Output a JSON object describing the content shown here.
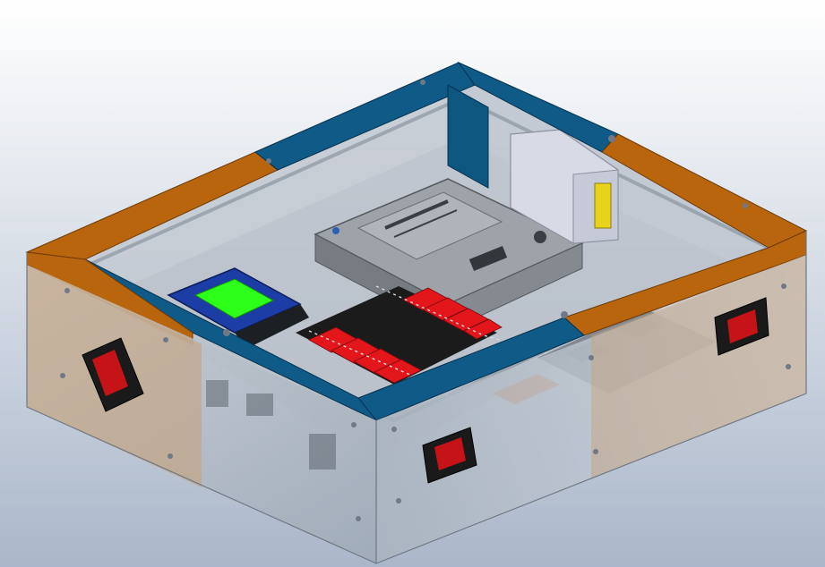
{
  "scene": {
    "background_light": "#ffffff",
    "background_dark": "#aab7ca",
    "colors": {
      "frame_blue": "#0f5a86",
      "frame_blue_dark": "#0a3f60",
      "frame_orange": "#b9650e",
      "frame_orange_dark": "#8a4808",
      "panel_glass": "#b9c3cf",
      "panel_tan": "#c7a17a",
      "board_gray": "#9ea3aa",
      "display_blue": "#1d3da6",
      "display_green": "#2dff1a",
      "terminal_red": "#e3161b",
      "terminal_black": "#1b1b1b",
      "switch_red": "#c51318"
    },
    "icons": [
      "rocker-switch-icon",
      "rocker-switch-icon",
      "rocker-switch-icon"
    ]
  }
}
